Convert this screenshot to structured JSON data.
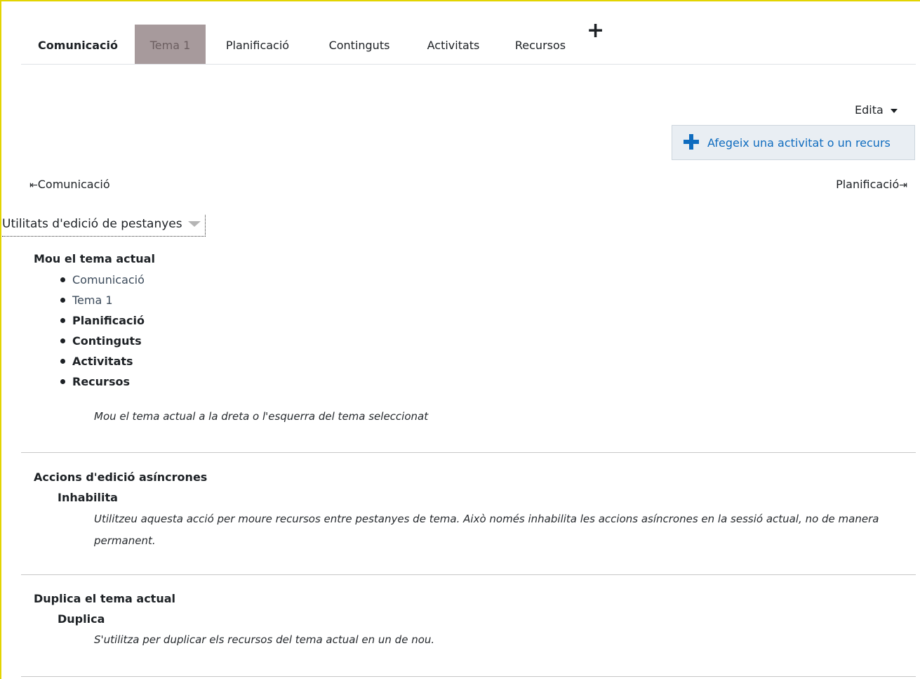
{
  "tabs": [
    {
      "label": "Comunicació",
      "bold": true
    },
    {
      "label": "Tema 1",
      "active": true
    },
    {
      "label": "Planificació"
    },
    {
      "label": "Continguts"
    },
    {
      "label": "Activitats"
    },
    {
      "label": "Recursos"
    }
  ],
  "tab_add_label": "+",
  "edit_menu": {
    "label": "Edita"
  },
  "add_activity": {
    "label": "Afegeix una activitat o un recurs"
  },
  "nav": {
    "prev": "Comunicació",
    "next": "Planificació"
  },
  "utilities": {
    "label": "Utilitats d'edició de pestanyes"
  },
  "move": {
    "title": "Mou el tema actual",
    "targets": [
      "Comunicació",
      "Tema 1",
      "Planificació",
      "Continguts",
      "Activitats",
      "Recursos"
    ],
    "note": "Mou el tema actual a la dreta o l'esquerra del tema seleccionat"
  },
  "async": {
    "title": "Accions d'edició asíncrones",
    "action": "Inhabilita",
    "note": "Utilitzeu aquesta acció per moure recursos entre pestanyes de tema. Això només inhabilita les accions asíncrones en la sessió actual, no de manera permanent."
  },
  "duplicate": {
    "title": "Duplica el tema actual",
    "action": "Duplica",
    "note": "S'utilitza per duplicar els recursos del tema actual en un de nou."
  },
  "colors": {
    "accent": "#0f6cbf",
    "active_tab": "#a79a9c",
    "frame": "#e3d400"
  }
}
